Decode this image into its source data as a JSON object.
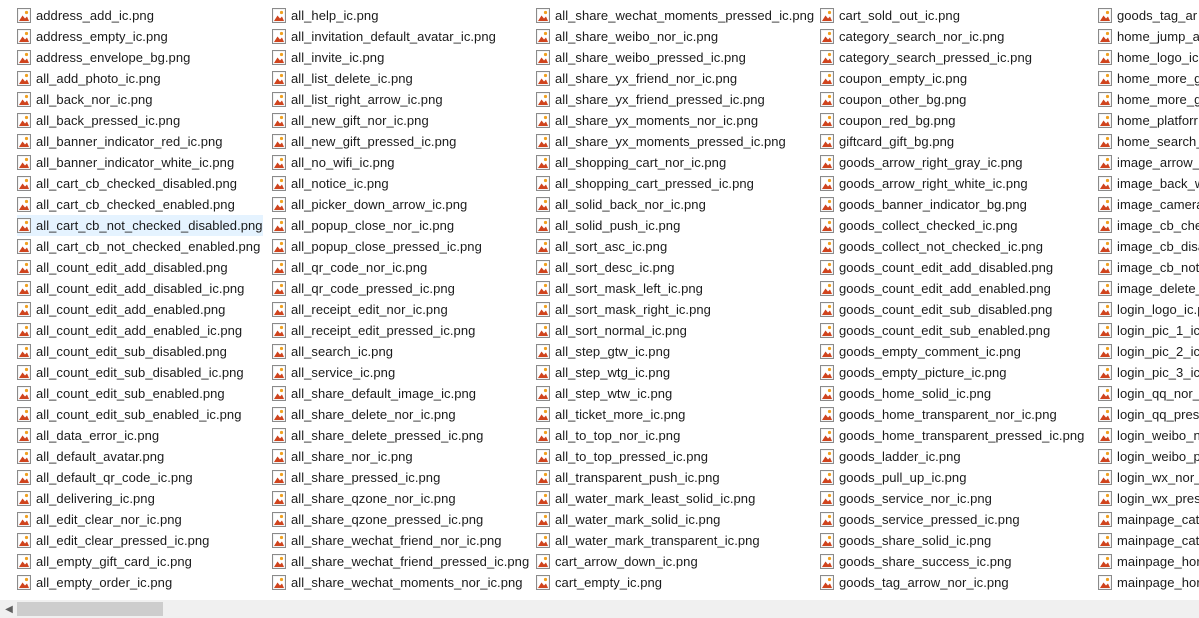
{
  "file_icon": "png-image-file-icon",
  "selected_file": "all_cart_cb_not_checked_disabled.png",
  "scrollbar": {
    "left_arrow_icon": "scroll-left-arrow-icon",
    "left_arrow_glyph": "◀"
  },
  "columns": [
    [
      "address_add_ic.png",
      "address_empty_ic.png",
      "address_envelope_bg.png",
      "all_add_photo_ic.png",
      "all_back_nor_ic.png",
      "all_back_pressed_ic.png",
      "all_banner_indicator_red_ic.png",
      "all_banner_indicator_white_ic.png",
      "all_cart_cb_checked_disabled.png",
      "all_cart_cb_checked_enabled.png",
      "all_cart_cb_not_checked_disabled.png",
      "all_cart_cb_not_checked_enabled.png",
      "all_count_edit_add_disabled.png",
      "all_count_edit_add_disabled_ic.png",
      "all_count_edit_add_enabled.png",
      "all_count_edit_add_enabled_ic.png",
      "all_count_edit_sub_disabled.png",
      "all_count_edit_sub_disabled_ic.png",
      "all_count_edit_sub_enabled.png",
      "all_count_edit_sub_enabled_ic.png",
      "all_data_error_ic.png",
      "all_default_avatar.png",
      "all_default_qr_code_ic.png",
      "all_delivering_ic.png",
      "all_edit_clear_nor_ic.png",
      "all_edit_clear_pressed_ic.png",
      "all_empty_gift_card_ic.png",
      "all_empty_order_ic.png"
    ],
    [
      "all_help_ic.png",
      "all_invitation_default_avatar_ic.png",
      "all_invite_ic.png",
      "all_list_delete_ic.png",
      "all_list_right_arrow_ic.png",
      "all_new_gift_nor_ic.png",
      "all_new_gift_pressed_ic.png",
      "all_no_wifi_ic.png",
      "all_notice_ic.png",
      "all_picker_down_arrow_ic.png",
      "all_popup_close_nor_ic.png",
      "all_popup_close_pressed_ic.png",
      "all_qr_code_nor_ic.png",
      "all_qr_code_pressed_ic.png",
      "all_receipt_edit_nor_ic.png",
      "all_receipt_edit_pressed_ic.png",
      "all_search_ic.png",
      "all_service_ic.png",
      "all_share_default_image_ic.png",
      "all_share_delete_nor_ic.png",
      "all_share_delete_pressed_ic.png",
      "all_share_nor_ic.png",
      "all_share_pressed_ic.png",
      "all_share_qzone_nor_ic.png",
      "all_share_qzone_pressed_ic.png",
      "all_share_wechat_friend_nor_ic.png",
      "all_share_wechat_friend_pressed_ic.png",
      "all_share_wechat_moments_nor_ic.png"
    ],
    [
      "all_share_wechat_moments_pressed_ic.png",
      "all_share_weibo_nor_ic.png",
      "all_share_weibo_pressed_ic.png",
      "all_share_yx_friend_nor_ic.png",
      "all_share_yx_friend_pressed_ic.png",
      "all_share_yx_moments_nor_ic.png",
      "all_share_yx_moments_pressed_ic.png",
      "all_shopping_cart_nor_ic.png",
      "all_shopping_cart_pressed_ic.png",
      "all_solid_back_nor_ic.png",
      "all_solid_push_ic.png",
      "all_sort_asc_ic.png",
      "all_sort_desc_ic.png",
      "all_sort_mask_left_ic.png",
      "all_sort_mask_right_ic.png",
      "all_sort_normal_ic.png",
      "all_step_gtw_ic.png",
      "all_step_wtg_ic.png",
      "all_step_wtw_ic.png",
      "all_ticket_more_ic.png",
      "all_to_top_nor_ic.png",
      "all_to_top_pressed_ic.png",
      "all_transparent_push_ic.png",
      "all_water_mark_least_solid_ic.png",
      "all_water_mark_solid_ic.png",
      "all_water_mark_transparent_ic.png",
      "cart_arrow_down_ic.png",
      "cart_empty_ic.png"
    ],
    [
      "cart_sold_out_ic.png",
      "category_search_nor_ic.png",
      "category_search_pressed_ic.png",
      "coupon_empty_ic.png",
      "coupon_other_bg.png",
      "coupon_red_bg.png",
      "giftcard_gift_bg.png",
      "goods_arrow_right_gray_ic.png",
      "goods_arrow_right_white_ic.png",
      "goods_banner_indicator_bg.png",
      "goods_collect_checked_ic.png",
      "goods_collect_not_checked_ic.png",
      "goods_count_edit_add_disabled.png",
      "goods_count_edit_add_enabled.png",
      "goods_count_edit_sub_disabled.png",
      "goods_count_edit_sub_enabled.png",
      "goods_empty_comment_ic.png",
      "goods_empty_picture_ic.png",
      "goods_home_solid_ic.png",
      "goods_home_transparent_nor_ic.png",
      "goods_home_transparent_pressed_ic.png",
      "goods_ladder_ic.png",
      "goods_pull_up_ic.png",
      "goods_service_nor_ic.png",
      "goods_service_pressed_ic.png",
      "goods_share_solid_ic.png",
      "goods_share_success_ic.png",
      "goods_tag_arrow_nor_ic.png"
    ],
    [
      "goods_tag_ar",
      "home_jump_ar",
      "home_logo_ic.",
      "home_more_g",
      "home_more_g",
      "home_platforr",
      "home_search_",
      "image_arrow_",
      "image_back_w",
      "image_camera",
      "image_cb_che",
      "image_cb_disa",
      "image_cb_not_",
      "image_delete_",
      "login_logo_ic.p",
      "login_pic_1_ic.",
      "login_pic_2_ic.",
      "login_pic_3_ic.",
      "login_qq_nor_i",
      "login_qq_pres",
      "login_weibo_n",
      "login_weibo_p",
      "login_wx_nor_i",
      "login_wx_press",
      "mainpage_cate",
      "mainpage_cate",
      "mainpage_hor",
      "mainpage_hor"
    ]
  ]
}
